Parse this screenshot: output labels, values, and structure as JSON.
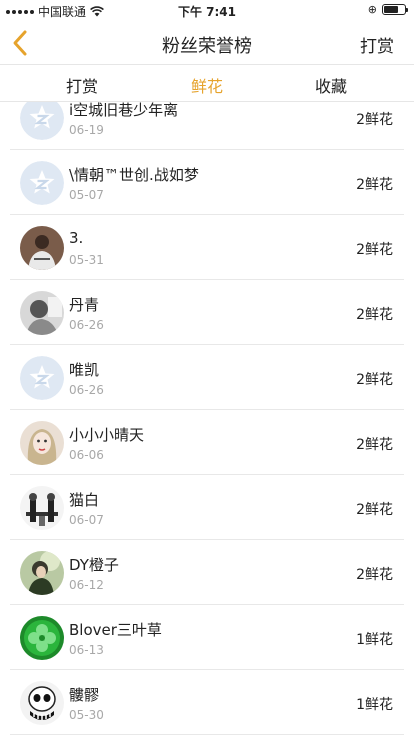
{
  "status": {
    "carrier": "中国联通",
    "time": "下午 7:41"
  },
  "nav": {
    "title": "粉丝荣誉榜",
    "right_label": "打赏"
  },
  "tabs": [
    {
      "label": "打赏"
    },
    {
      "label": "鲜花"
    },
    {
      "label": "收藏"
    }
  ],
  "active_tab": "鲜花",
  "colors": {
    "accent": "#e6a32c",
    "default_avatar_bg": "#dfe8f3",
    "default_avatar_fg": "#ffffff"
  },
  "rows": [
    {
      "name": "i空城旧巷少年离",
      "date": "06-19",
      "count": "2鲜花",
      "avatar": "default"
    },
    {
      "name": "\\情朝™世创.战如梦",
      "date": "05-07",
      "count": "2鲜花",
      "avatar": "default"
    },
    {
      "name": "3.",
      "date": "05-31",
      "count": "2鲜花",
      "avatar": "photo-person"
    },
    {
      "name": "丹青",
      "date": "06-26",
      "count": "2鲜花",
      "avatar": "photo-gray"
    },
    {
      "name": "唯凯",
      "date": "06-26",
      "count": "2鲜花",
      "avatar": "default"
    },
    {
      "name": "小小小晴天",
      "date": "06-06",
      "count": "2鲜花",
      "avatar": "photo-girl"
    },
    {
      "name": "猫白",
      "date": "06-07",
      "count": "2鲜花",
      "avatar": "photo-bw"
    },
    {
      "name": "DY橙子",
      "date": "06-12",
      "count": "2鲜花",
      "avatar": "photo-green-person"
    },
    {
      "name": "Blover三叶草",
      "date": "06-13",
      "count": "1鲜花",
      "avatar": "photo-clover"
    },
    {
      "name": "髏髎",
      "date": "05-30",
      "count": "1鲜花",
      "avatar": "photo-skull"
    }
  ]
}
